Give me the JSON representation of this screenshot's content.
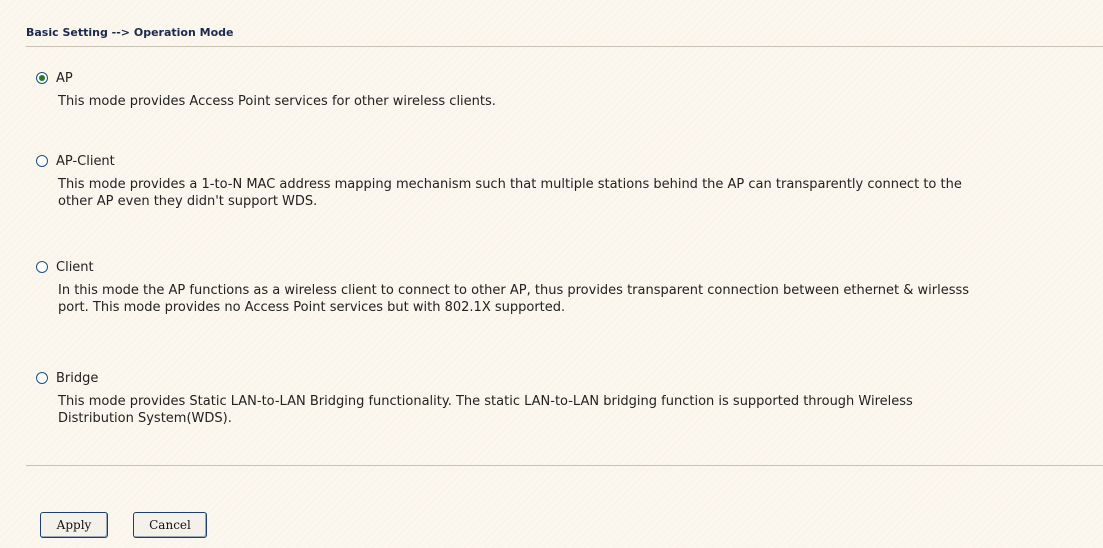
{
  "breadcrumb": "Basic Setting --> Operation Mode",
  "modes": [
    {
      "label": "AP",
      "selected": true,
      "description": "This mode provides Access Point services for other wireless clients."
    },
    {
      "label": "AP-Client",
      "selected": false,
      "description": "This mode provides a 1-to-N MAC address mapping mechanism such that multiple stations behind the AP can transparently connect to the other AP even they didn't support WDS."
    },
    {
      "label": "Client",
      "selected": false,
      "description": "In this mode the AP functions as a wireless client to connect to other AP, thus provides transparent connection between ethernet & wirlesss port. This mode provides no Access Point services but with 802.1X supported."
    },
    {
      "label": "Bridge",
      "selected": false,
      "description": "This mode provides Static LAN-to-LAN Bridging functionality. The static LAN-to-LAN bridging function is supported through Wireless Distribution System(WDS)."
    }
  ],
  "buttons": {
    "apply": "Apply",
    "cancel": "Cancel"
  }
}
